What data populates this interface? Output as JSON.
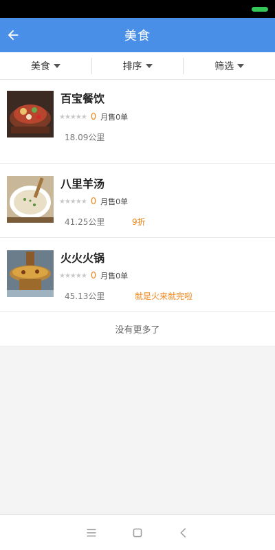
{
  "header": {
    "title": "美食"
  },
  "filters": [
    {
      "label": "美食"
    },
    {
      "label": "排序"
    },
    {
      "label": "筛选"
    }
  ],
  "stores": [
    {
      "name": "百宝餐饮",
      "rating": "0",
      "sales": "月售0单",
      "distance": "18.09公里",
      "promo": ""
    },
    {
      "name": "八里羊汤",
      "rating": "0",
      "sales": "月售0单",
      "distance": "41.25公里",
      "promo": "9折"
    },
    {
      "name": "火火火锅",
      "rating": "0",
      "sales": "月售0单",
      "distance": "45.13公里",
      "promo": "就是火来就完啦"
    }
  ],
  "footer": {
    "no_more": "没有更多了"
  },
  "colors": {
    "header_bg": "#4a8fe7",
    "accent": "#f08519"
  }
}
